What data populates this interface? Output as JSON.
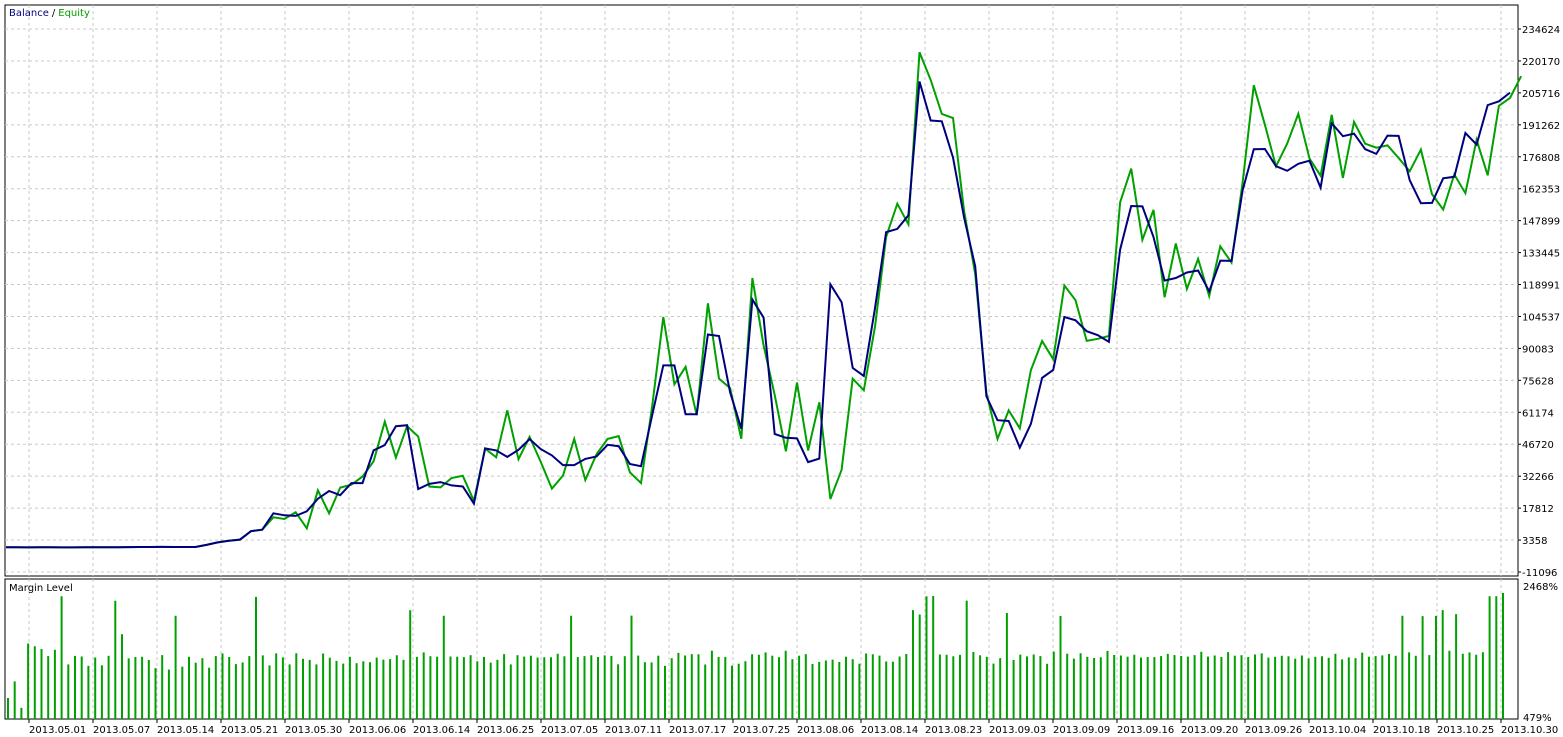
{
  "chart_data": [
    {
      "type": "line",
      "title": "",
      "legend": {
        "placement": "top-left",
        "separator": "/"
      },
      "series": [
        {
          "name": "Balance",
          "color": "#00007f",
          "values": [
            80,
            60,
            20,
            60,
            60,
            40,
            50,
            80,
            70,
            90,
            140,
            160,
            200,
            210,
            250,
            230,
            220,
            220,
            1150,
            2320,
            3020,
            3580,
            7420,
            8050,
            15450,
            14560,
            14300,
            16390,
            22080,
            25580,
            23680,
            29140,
            29140,
            43910,
            46370,
            54900,
            55320,
            26480,
            28780,
            29590,
            28080,
            27610,
            19870,
            44820,
            43950,
            41010,
            44200,
            49050,
            44530,
            41690,
            37300,
            37300,
            40070,
            41170,
            46470,
            45840,
            37790,
            36780,
            59890,
            82410,
            82410,
            60320,
            60300,
            96380,
            95700,
            70250,
            53730,
            112190,
            104030,
            51330,
            49620,
            49360,
            38620,
            40230,
            119110,
            111010,
            81280,
            77610,
            108270,
            142650,
            144180,
            150340,
            210870,
            193230,
            192870,
            176470,
            149300,
            127240,
            68470,
            57580,
            57230,
            45190,
            55980,
            76760,
            80340,
            104300,
            102790,
            97850,
            96070,
            93040,
            134730,
            154530,
            154350,
            140510,
            120750,
            121940,
            124420,
            125350,
            115920,
            129810,
            129680,
            161580,
            180220,
            180300,
            172560,
            170440,
            173630,
            175040,
            162830,
            192010,
            186110,
            187270,
            180240,
            178100,
            186370,
            186230,
            166210,
            155780,
            155950,
            167050,
            167750,
            187560,
            182290,
            200190,
            201920,
            205840
          ]
        },
        {
          "name": "Equity",
          "color": "#00a000",
          "values": [
            80,
            60,
            20,
            60,
            60,
            40,
            50,
            80,
            70,
            90,
            140,
            160,
            200,
            210,
            250,
            230,
            220,
            220,
            1150,
            2320,
            3020,
            3580,
            7420,
            8050,
            13650,
            12900,
            15970,
            8660,
            25860,
            15450,
            27080,
            28420,
            32070,
            39010,
            56930,
            40670,
            54910,
            50230,
            27580,
            27200,
            31460,
            32450,
            21080,
            44740,
            40820,
            62060,
            39960,
            50040,
            38680,
            26650,
            32560,
            49070,
            30540,
            42220,
            49140,
            50410,
            34010,
            29140,
            64040,
            104310,
            73830,
            81780,
            59870,
            110490,
            76420,
            72140,
            49180,
            121910,
            91380,
            69050,
            43520,
            74640,
            43890,
            65680,
            21960,
            35140,
            76370,
            71150,
            99890,
            140500,
            155590,
            146250,
            224080,
            211540,
            196210,
            194350,
            152240,
            123840,
            70060,
            49120,
            62040,
            53920,
            80290,
            93430,
            85180,
            118570,
            111900,
            93480,
            94410,
            95710,
            156160,
            171470,
            139250,
            152740,
            113220,
            137570,
            116960,
            130600,
            113790,
            136270,
            128900,
            165060,
            209210,
            191290,
            172480,
            182780,
            196230,
            176000,
            168230,
            195800,
            167230,
            192600,
            182700,
            180890,
            181950,
            176250,
            170220,
            180050,
            159850,
            152900,
            168760,
            160330,
            184480,
            168410,
            199880,
            203440,
            213270
          ]
        }
      ],
      "x_tick_labels": [
        "2013.05.01",
        "2013.05.07",
        "2013.05.14",
        "2013.05.21",
        "2013.05.30",
        "2013.06.06",
        "2013.06.14",
        "2013.06.25",
        "2013.07.05",
        "2013.07.11",
        "2013.07.17",
        "2013.07.25",
        "2013.08.06",
        "2013.08.14",
        "2013.08.23",
        "2013.09.03",
        "2013.09.09",
        "2013.09.16",
        "2013.09.20",
        "2013.09.26",
        "2013.10.04",
        "2013.10.18",
        "2013.10.25",
        "2013.10.30"
      ],
      "y_tick_labels": [
        "234624",
        "220170",
        "205716",
        "191262",
        "176808",
        "162353",
        "147899",
        "133445",
        "118991",
        "104537",
        "90083",
        "75628",
        "61174",
        "46720",
        "32266",
        "17812",
        "3358",
        "-11096"
      ],
      "ylim": [
        -11096,
        234624
      ],
      "grid": true
    },
    {
      "type": "bar",
      "title": "Margin Level",
      "color": "#00a000",
      "ylim": [
        479,
        2468
      ],
      "y_tick_labels": [
        "2468%",
        "479%"
      ],
      "values": [
        790,
        1037,
        645,
        1600,
        1560,
        1517,
        1412,
        1506,
        2300,
        1290,
        1415,
        1406,
        1268,
        1392,
        1276,
        1417,
        2235,
        1737,
        1379,
        1399,
        1402,
        1356,
        1234,
        1427,
        1213,
        2013,
        1256,
        1402,
        1315,
        1381,
        1241,
        1412,
        1452,
        1399,
        1294,
        1319,
        1412,
        2291,
        1423,
        1275,
        1452,
        1394,
        1290,
        1454,
        1372,
        1356,
        1290,
        1451,
        1389,
        1342,
        1302,
        1402,
        1307,
        1336,
        1322,
        1391,
        1359,
        1368,
        1424,
        1358,
        2093,
        1401,
        1468,
        1411,
        1404,
        2012,
        1407,
        1403,
        1398,
        1426,
        1335,
        1401,
        1316,
        1358,
        1443,
        1289,
        1426,
        1405,
        1418,
        1392,
        1397,
        1395,
        1448,
        1409,
        2013,
        1398,
        1412,
        1424,
        1399,
        1423,
        1415,
        1291,
        1411,
        2014,
        1420,
        1322,
        1319,
        1419,
        1269,
        1382,
        1460,
        1421,
        1442,
        1440,
        1288,
        1492,
        1401,
        1401,
        1270,
        1300,
        1337,
        1441,
        1433,
        1468,
        1419,
        1397,
        1491,
        1366,
        1418,
        1442,
        1295,
        1326,
        1347,
        1360,
        1325,
        1404,
        1367,
        1300,
        1451,
        1441,
        1420,
        1332,
        1329,
        1406,
        1444,
        2095,
        2030,
        2300,
        2304,
        1437,
        1432,
        1409,
        1431,
        2236,
        1473,
        1424,
        1402,
        1301,
        1383,
        2052,
        1355,
        1435,
        1408,
        1436,
        1413,
        1298,
        1479,
        2008,
        1447,
        1376,
        1455,
        1402,
        1384,
        1395,
        1490,
        1429,
        1421,
        1403,
        1432,
        1390,
        1400,
        1398,
        1412,
        1446,
        1427,
        1414,
        1405,
        1428,
        1476,
        1405,
        1421,
        1399,
        1472,
        1419,
        1426,
        1400,
        1436,
        1452,
        1391,
        1402,
        1417,
        1409,
        1374,
        1422,
        1378,
        1402,
        1409,
        1388,
        1447,
        1364,
        1393,
        1382,
        1465,
        1403,
        1412,
        1423,
        1446,
        1417,
        2012,
        1468,
        1417,
        2006,
        1428,
        2009,
        2095,
        1492,
        2036,
        1447,
        1467,
        1432,
        1470,
        2301,
        2300,
        2350
      ]
    }
  ]
}
